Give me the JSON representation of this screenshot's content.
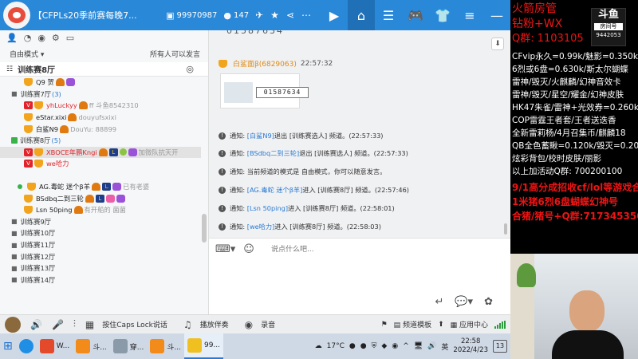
{
  "titlebar": {
    "channel_title": "【CFPLs20季前赛每晚7...",
    "channel_id": "99970987",
    "online_count": "147"
  },
  "left": {
    "mode_label": "自由模式",
    "permission_note": "所有人可以发言",
    "current_channel": "训练赛8厅"
  },
  "tree": {
    "r0": {
      "name": "Q9 贺"
    },
    "r1": {
      "name": "训练赛7厅",
      "count": "(3)"
    },
    "r2": {
      "name": "yhLuckyy",
      "extra": "ff 斗鱼8542310"
    },
    "r3": {
      "name": "eStar.xixi",
      "extra": "douyufsxixi"
    },
    "r4": {
      "name": "白鲨N9",
      "extra": "DouYu: 88899"
    },
    "r5": {
      "name": "训练赛8厅",
      "count": "(5)"
    },
    "r6": {
      "name": "XBOCE年鹏Kngi",
      "extra": "加微队抗天开"
    },
    "r7": {
      "name": "we哈力"
    },
    "r8": {
      "name": "AG.毒蛇 迷个β羊",
      "extra": "已有老婆"
    },
    "r9": {
      "name": "BSdbq二到三轮"
    },
    "r10": {
      "name": "Lsn 50ping",
      "extra": "有开船的 菌菌"
    },
    "r11": {
      "name": "训练赛9厅"
    },
    "r12": {
      "name": "训练赛10厅"
    },
    "r13": {
      "name": "训练赛11厅"
    },
    "r14": {
      "name": "训练赛12厅"
    },
    "r15": {
      "name": "训练赛13厅"
    },
    "r16": {
      "name": "训练赛14厅"
    }
  },
  "chat": {
    "top_partial": "01587634",
    "image_msg": {
      "sender": "白鲨面β(6829063)",
      "time": "22:57:32",
      "image_code": "01587634"
    },
    "notices": [
      {
        "prefix": "通知:",
        "user": "[白鲨N9]",
        "action": " 退出 [训练赛选人] 频道。",
        "time": "(22:57:33)"
      },
      {
        "prefix": "通知:",
        "user": "[BSdbq二到三轮]",
        "action": " 退出 [训练赛选人] 频道。",
        "time": "(22:57:33)"
      },
      {
        "prefix": "通知:",
        "user": "",
        "action": "当前频道的模式是 自由模式，你可以随意发言。",
        "time": ""
      },
      {
        "prefix": "通知:",
        "user": "[AG.毒蛇 迷个β羊]",
        "action": " 进入 [训练赛8厅] 频道。",
        "time": "(22:57:46)"
      },
      {
        "prefix": "通知:",
        "user": "[Lsn 50ping]",
        "action": " 进入 [训练赛8厅] 频道。",
        "time": "(22:58:01)"
      },
      {
        "prefix": "通知:",
        "user": "[we哈力]",
        "action": " 进入 [训练赛8厅] 频道。",
        "time": "(22:58:03)"
      }
    ],
    "input_placeholder": "说点什么吧..."
  },
  "bottombar": {
    "ptt_label": "按住Caps Lock说话",
    "music_label": "播放伴奏",
    "record_label": "录音",
    "template_label": "频道模板",
    "app_center_label": "应用中心"
  },
  "taskbar": {
    "items": [
      "W...",
      "斗...",
      "穿...",
      "斗...",
      "99..."
    ],
    "weather": "17°C",
    "ime": "英",
    "time": "22:58",
    "date": "2022/4/23",
    "notifications": "13"
  },
  "overlay": {
    "lines": [
      "火箭房管",
      "钻粉+WX",
      "Q群: 1103105",
      "CFvip永久=0.99k/魅影=0.350k",
      "6烈或6盘=0.630k/斯太尔蝴蝶",
      "雷神/毁灭/火麒麟/幻神音效卡",
      "雷神/毁灭/星空/耀金/幻神皮肤",
      "HK47朱雀/雷神+光效券=0.260k",
      "COP雷霆王者套/王者送迭香",
      "全新雷莉杨/4月召集币/麒麟18",
      "QB全色蓄瞅=0.120k/毁灭=0.205k",
      "炫彩背包/校时皮肤/丽影",
      "以上加活动Q群: 700200100",
      "9/1高分成招收cf/lol等游戏合",
      "1米猪6烈6盘蝴蝶幻神号",
      "合猪/猪号+Q群:717345350"
    ],
    "logo_main": "斗鱼",
    "logo_sub": "房间号",
    "room_number": "9442053"
  }
}
